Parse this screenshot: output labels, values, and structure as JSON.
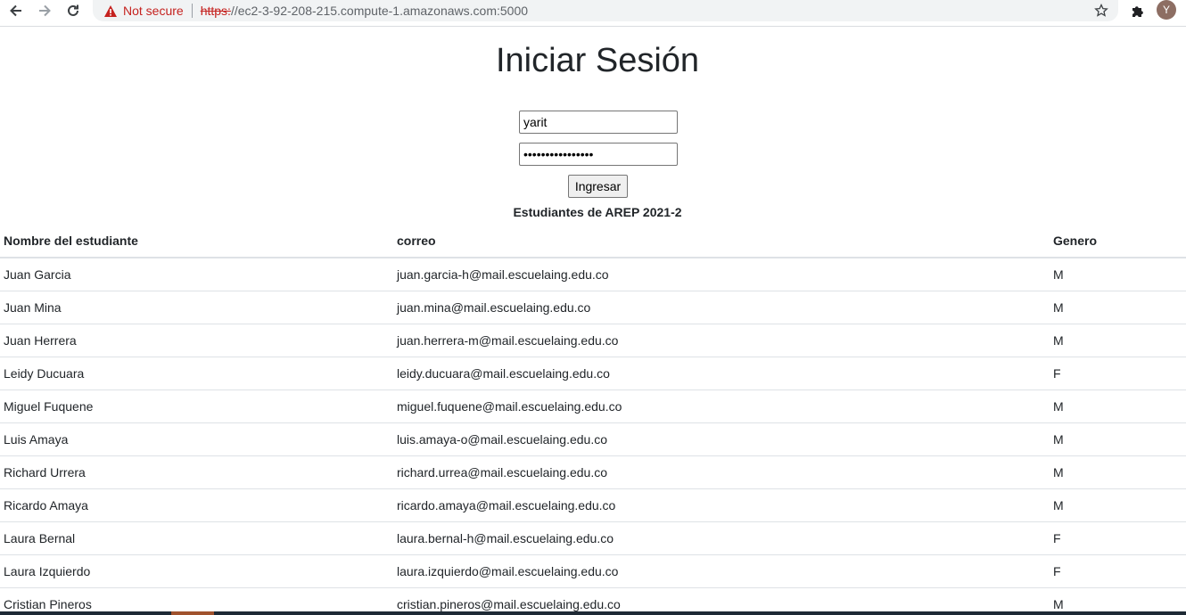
{
  "browser": {
    "security_label": "Not secure",
    "url_scheme": "https:",
    "url_rest": "//ec2-3-92-208-215.compute-1.amazonaws.com:5000",
    "avatar_letter": "Y"
  },
  "login": {
    "title": "Iniciar Sesión",
    "username_value": "yarit",
    "password_value": "passwordpassword",
    "submit_label": "Ingresar"
  },
  "table": {
    "caption": "Estudiantes de AREP 2021-2",
    "headers": [
      "Nombre del estudiante",
      "correo",
      "Genero"
    ],
    "rows": [
      [
        "Juan Garcia",
        "juan.garcia-h@mail.escuelaing.edu.co",
        "M"
      ],
      [
        "Juan Mina",
        "juan.mina@mail.escuelaing.edu.co",
        "M"
      ],
      [
        "Juan Herrera",
        "juan.herrera-m@mail.escuelaing.edu.co",
        "M"
      ],
      [
        "Leidy Ducuara",
        "leidy.ducuara@mail.escuelaing.edu.co",
        "F"
      ],
      [
        "Miguel Fuquene",
        "miguel.fuquene@mail.escuelaing.edu.co",
        "M"
      ],
      [
        "Luis Amaya",
        "luis.amaya-o@mail.escuelaing.edu.co",
        "M"
      ],
      [
        "Richard Urrera",
        "richard.urrea@mail.escuelaing.edu.co",
        "M"
      ],
      [
        "Ricardo Amaya",
        "ricardo.amaya@mail.escuelaing.edu.co",
        "M"
      ],
      [
        "Laura Bernal",
        "laura.bernal-h@mail.escuelaing.edu.co",
        "F"
      ],
      [
        "Laura Izquierdo",
        "laura.izquierdo@mail.escuelaing.edu.co",
        "F"
      ],
      [
        "Cristian Pineros",
        "cristian.pineros@mail.escuelaing.edu.co",
        "M"
      ]
    ]
  }
}
